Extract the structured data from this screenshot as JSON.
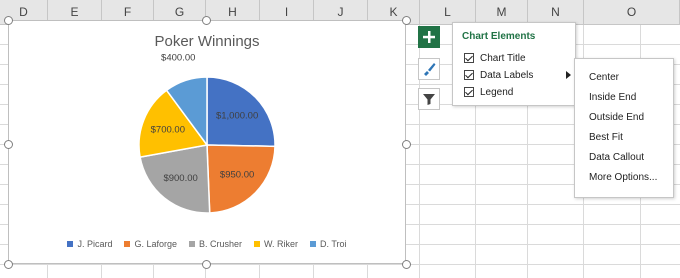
{
  "columns": [
    "D",
    "E",
    "F",
    "G",
    "H",
    "I",
    "J",
    "K",
    "L",
    "M",
    "N",
    "O"
  ],
  "chart": {
    "title": "Poker Winnings"
  },
  "chart_data": {
    "type": "pie",
    "title": "Poker Winnings",
    "categories": [
      "J. Picard",
      "G. Laforge",
      "B. Crusher",
      "W. Riker",
      "D. Troi"
    ],
    "values": [
      1000,
      950,
      900,
      700,
      400
    ],
    "labels": [
      "$1,000.00",
      "$950.00",
      "$900.00",
      "$700.00",
      "$400.00"
    ],
    "colors": [
      "#4472c4",
      "#ed7d31",
      "#a5a5a5",
      "#ffc000",
      "#5b9bd5"
    ],
    "legend": "bottom"
  },
  "tools": {
    "add_icon": "plus-icon",
    "style_icon": "brush-icon",
    "filter_icon": "filter-icon"
  },
  "panel": {
    "title": "Chart Elements",
    "items": [
      {
        "label": "Chart Title",
        "checked": true
      },
      {
        "label": "Data Labels",
        "checked": true
      },
      {
        "label": "Legend",
        "checked": true
      }
    ]
  },
  "submenu": {
    "items": [
      "Center",
      "Inside End",
      "Outside End",
      "Best Fit",
      "Data Callout",
      "More Options..."
    ]
  }
}
